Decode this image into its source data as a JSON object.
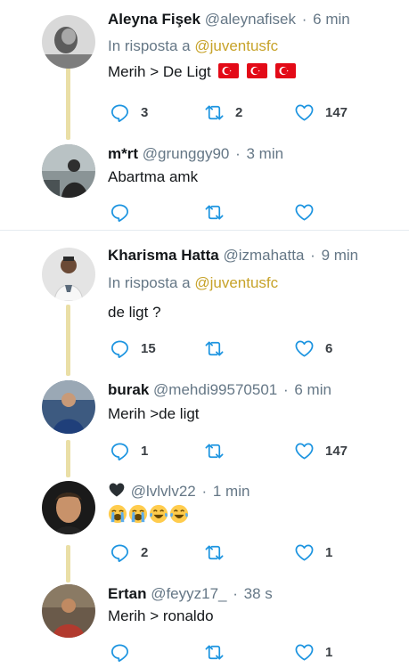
{
  "tweets": [
    {
      "name": "Aleyna Fişek",
      "handle": "@aleynafisek",
      "separator": "·",
      "time": "6 min",
      "reply_prefix": "In risposta a",
      "reply_mention": "@juventusfc",
      "text": "Merih > De Ligt",
      "flags": [
        "turkey-flag-icon",
        "turkey-flag-icon",
        "turkey-flag-icon"
      ],
      "replies": "3",
      "retweets": "2",
      "likes": "147"
    },
    {
      "name": "m*rt",
      "handle": "@grunggy90",
      "separator": "·",
      "time": "3 min",
      "text": "Abartma amk",
      "replies": "",
      "retweets": "",
      "likes": ""
    },
    {
      "name": "Kharisma Hatta",
      "handle": "@izmahatta",
      "separator": "·",
      "time": "9 min",
      "reply_prefix": "In risposta a",
      "reply_mention": "@juventusfc",
      "text": "de ligt ?",
      "replies": "15",
      "retweets": "",
      "likes": "6"
    },
    {
      "name": "burak",
      "handle": "@mehdi99570501",
      "separator": "·",
      "time": "6 min",
      "text": "Merih >de ligt",
      "replies": "1",
      "retweets": "",
      "likes": "147"
    },
    {
      "name": "black-heart-emoji",
      "handle": "@lvlvlv22",
      "separator": "·",
      "time": "1 min",
      "emojis": [
        "crying-face-emoji",
        "crying-face-emoji",
        "tears-of-joy-emoji",
        "tears-of-joy-emoji"
      ],
      "replies": "2",
      "retweets": "",
      "likes": "1"
    },
    {
      "name": "Ertan",
      "handle": "@feyyz17_",
      "separator": "·",
      "time": "38 s",
      "text": "Merih > ronaldo",
      "replies": "",
      "retweets": "",
      "likes": "1"
    }
  ],
  "colors": {
    "mention": "#c7a32a",
    "thread_line": "#eadfa6",
    "muted": "#657786",
    "icon": "#1c94e0"
  }
}
